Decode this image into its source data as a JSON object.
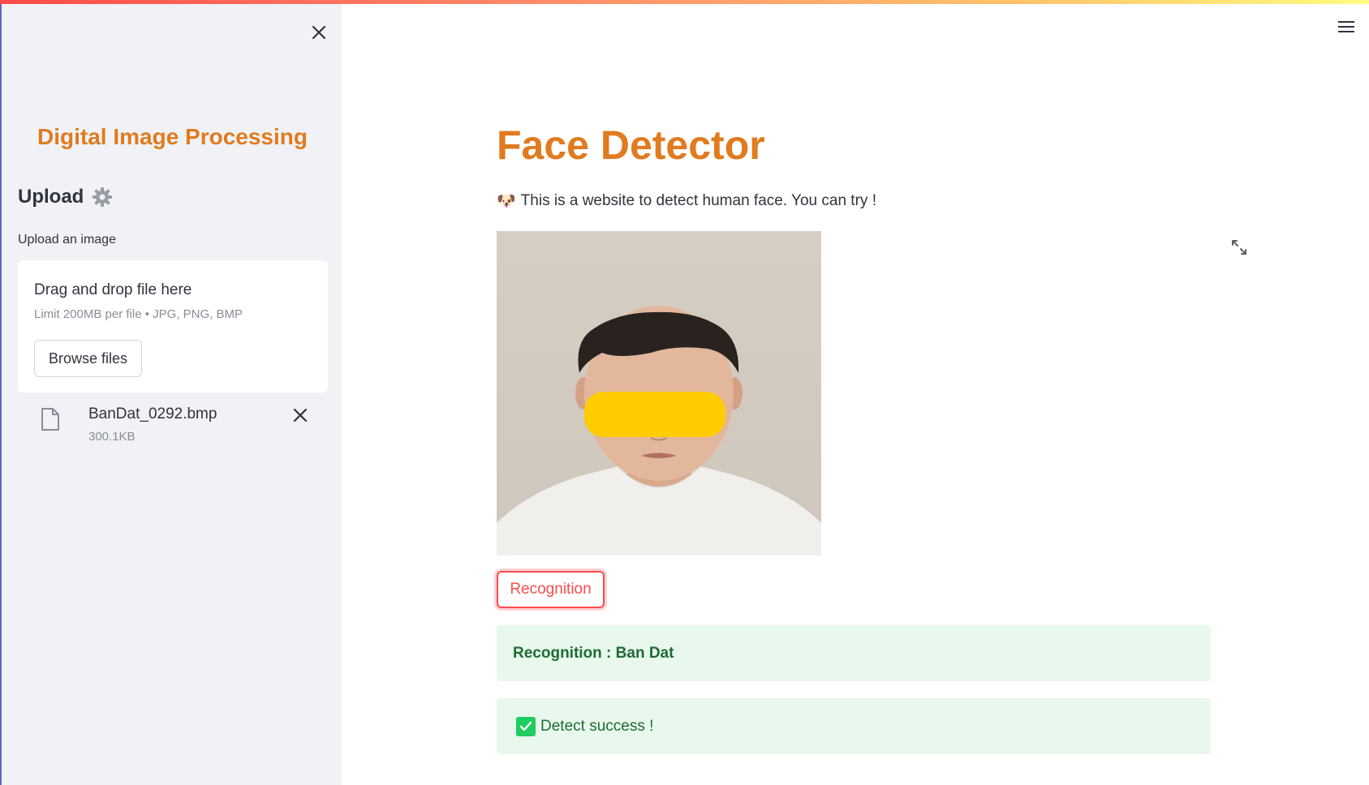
{
  "sidebar": {
    "title": "Digital Image Processing",
    "upload_heading": "Upload",
    "upload_label": "Upload an image",
    "dropzone": {
      "title": "Drag and drop file here",
      "limit": "Limit 200MB per file • JPG, PNG, BMP",
      "browse_label": "Browse files"
    },
    "file": {
      "name": "BanDat_0292.bmp",
      "size": "300.1KB"
    }
  },
  "main": {
    "title": "Face Detector",
    "intro_emoji": "🐶",
    "intro": "This is a website to detect human face. You can try !",
    "recognition_button": "Recognition",
    "result_text": "Recognition : Ban Dat",
    "success_text": "Detect success !"
  },
  "colors": {
    "accent": "#e07b1f",
    "primary_red": "#ff4b4b",
    "success_bg": "#e8f8ec",
    "success_text": "#1e6b35",
    "sidebar_bg": "#f0f2f6"
  },
  "icons": [
    "close-icon",
    "gear-icon",
    "file-icon",
    "remove-file-icon",
    "hamburger-menu-icon",
    "fullscreen-icon",
    "checkmark-icon"
  ]
}
